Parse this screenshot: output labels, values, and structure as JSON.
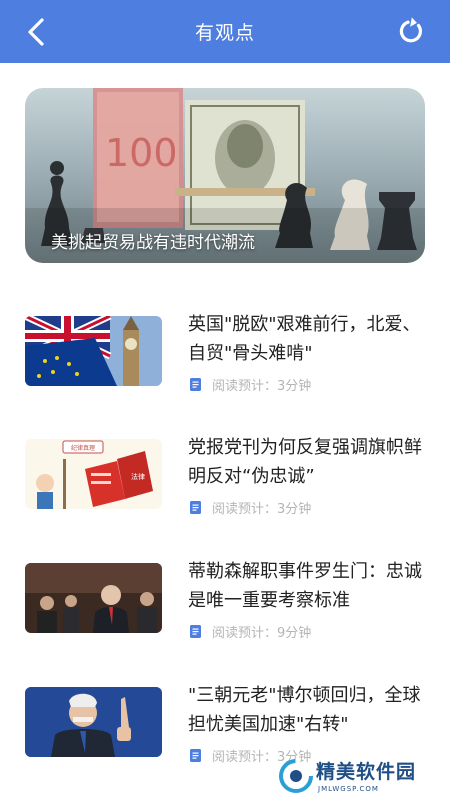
{
  "header": {
    "title": "有观点",
    "back_icon": "chevron-left-icon",
    "refresh_icon": "refresh-icon",
    "background": "#4d7ee0"
  },
  "hero": {
    "caption": "美挑起贸易战有违时代潮流"
  },
  "articles": [
    {
      "title": "英国\"脱欧\"艰难前行，北爱、自贸\"骨头难啃\"",
      "read_time": "阅读预计：3分钟"
    },
    {
      "title": "党报党刊为何反复强调旗帜鲜明反对“伪忠诚”",
      "read_time": "阅读预计：3分钟"
    },
    {
      "title": "蒂勒森解职事件罗生门：忠诚是唯一重要考察标准",
      "read_time": "阅读预计：9分钟"
    },
    {
      "title": "\"三朝元老\"博尔顿回归，全球担忧美国加速\"右转\"",
      "read_time": "阅读预计：3分钟"
    }
  ],
  "thumbnail_text": {
    "banner": "纪律真理",
    "box_label": "法律"
  },
  "watermark": {
    "title": "精美软件园",
    "url": "JMLWGSP.COM"
  },
  "colors": {
    "accent": "#4d7ee0",
    "meta_text": "#b5b5b5",
    "headline_text": "#222222"
  }
}
